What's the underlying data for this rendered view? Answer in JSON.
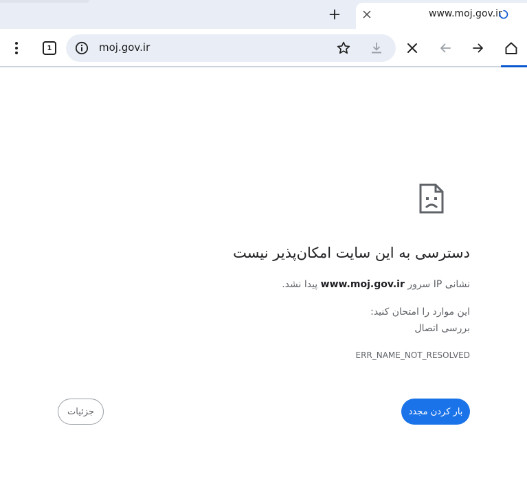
{
  "tab": {
    "title": "www.moj.gov.ir",
    "close_icon": "close-icon",
    "loading_icon": "spinner-icon"
  },
  "tabstrip": {
    "new_tab_icon": "plus-icon"
  },
  "toolbar": {
    "menu_icon": "kebab-menu-icon",
    "tab_count": "1",
    "stop_icon": "close-icon",
    "back_icon": "arrow-left-icon",
    "forward_icon": "arrow-right-icon",
    "home_icon": "home-icon"
  },
  "omnibox": {
    "url": "moj.gov.ir",
    "info_icon": "info-icon",
    "bookmark_icon": "star-icon",
    "download_icon": "download-icon"
  },
  "error": {
    "icon": "sad-page-icon",
    "title": "دسترسی به این سایت امکان‌پذیر نیست",
    "desc_prefix": "نشانی IP سرور ",
    "desc_host": "www.moj.gov.ir",
    "desc_suffix": " پیدا نشد.",
    "try_label": "این موارد را امتحان کنید:",
    "suggestion": "بررسی اتصال",
    "code": "ERR_NAME_NOT_RESOLVED",
    "reload_label": "بار کردن مجدد",
    "details_label": "جزئیات"
  },
  "colors": {
    "accent": "#1a73e8",
    "tabstrip_bg": "#e9eef6",
    "progress": "#0b57d0"
  }
}
